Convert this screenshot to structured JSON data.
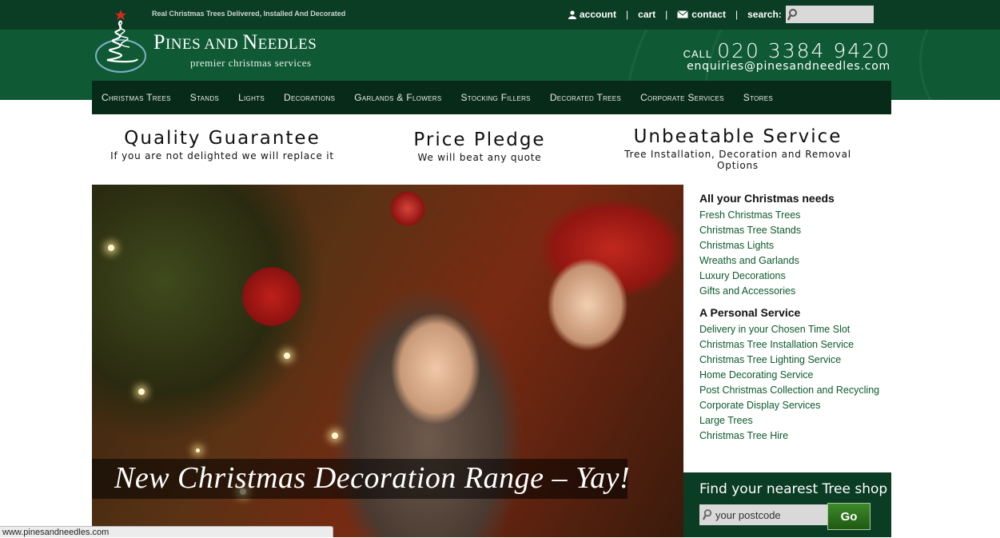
{
  "topbar": {
    "tagline": "Real Christmas Trees Delivered, Installed And Decorated",
    "links": {
      "account": "account",
      "cart": "cart",
      "contact": "contact",
      "search_label": "search:"
    },
    "separator": "|",
    "search_placeholder": ""
  },
  "brand": {
    "name_p": "P",
    "name_rest1": "INES AND ",
    "name_n": "N",
    "name_rest2": "EEDLES",
    "subtitle": "premier christmas services"
  },
  "contact": {
    "call_label": "CALL",
    "phone": "020 3384 9420",
    "email": "enquiries@pinesandneedles.com"
  },
  "nav": {
    "items": [
      "Christmas Trees",
      "Stands",
      "Lights",
      "Decorations",
      "Garlands & Flowers",
      "Stocking Fillers",
      "Decorated Trees",
      "Corporate Services",
      "Stores"
    ]
  },
  "promos": [
    {
      "title": "Quality Guarantee",
      "sub": "If you are not delighted we will replace it"
    },
    {
      "title": "Price Pledge",
      "sub": "We will beat any quote"
    },
    {
      "title": "Unbeatable Service",
      "sub": "Tree Installation, Decoration and Removal Options"
    }
  ],
  "hero": {
    "caption": "New Christmas Decoration Range – Yay!"
  },
  "sidebar": {
    "section1_title": "All your Christmas needs",
    "section1_links": [
      "Fresh Christmas Trees",
      "Christmas Tree Stands",
      "Christmas Lights",
      "Wreaths and Garlands",
      "Luxury Decorations",
      "Gifts and Accessories"
    ],
    "section2_title": "A Personal Service",
    "section2_links": [
      "Delivery in your Chosen Time Slot",
      "Christmas Tree Installation Service",
      "Christmas Tree Lighting Service",
      "Home Decorating Service",
      "Post Christmas Collection and Recycling",
      "Corporate Display Services",
      "Large Trees",
      "Christmas Tree Hire"
    ]
  },
  "shop_finder": {
    "title": "Find your nearest Tree shop",
    "postcode_placeholder": "your postcode",
    "go_label": "Go"
  },
  "status_bar": {
    "url": "www.pinesandneedles.com"
  },
  "colors": {
    "topbar": "#0b3d24",
    "header": "#0f5a34",
    "nav": "#082a18",
    "link_green": "#0d5a2e",
    "go_button": "#2f7420"
  },
  "icons": [
    "christmas-tree-logo",
    "person-icon",
    "envelope-icon",
    "magnifier-icon"
  ]
}
